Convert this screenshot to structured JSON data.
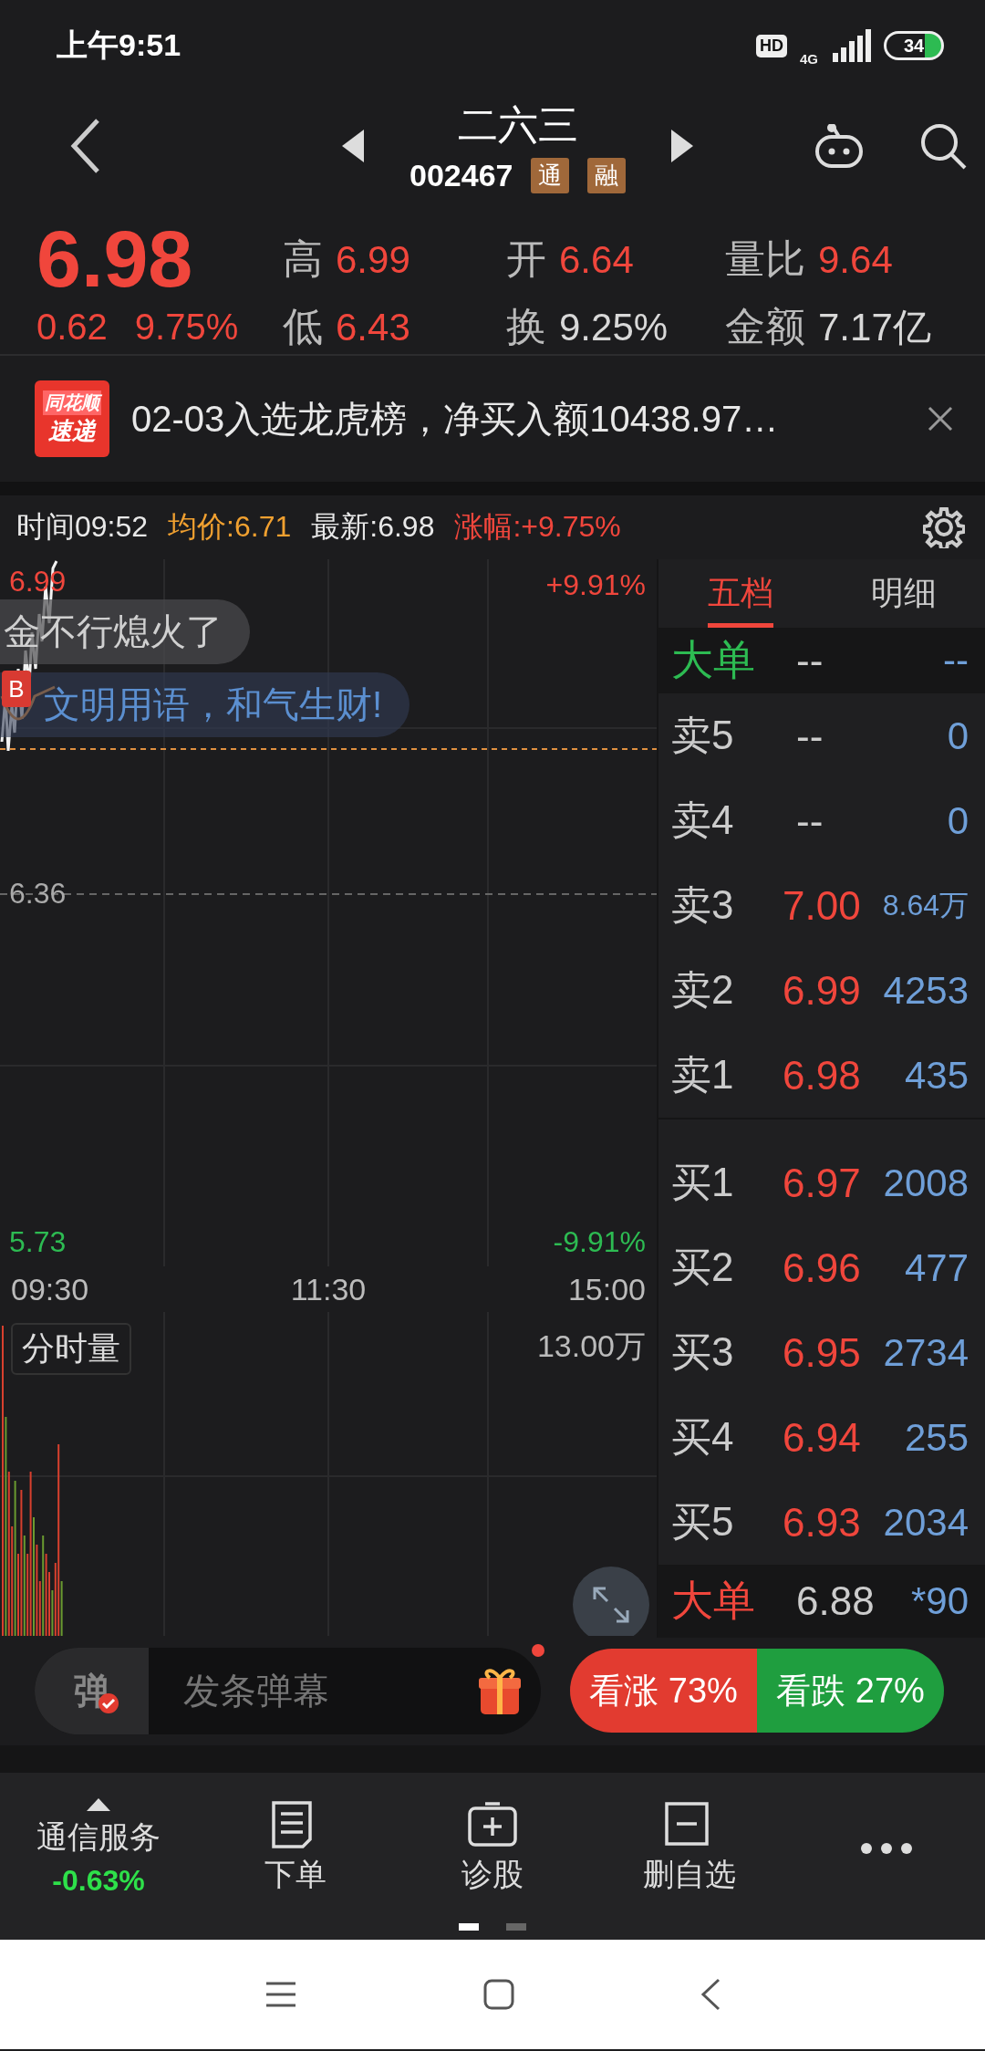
{
  "status_bar": {
    "time": "上午9:51",
    "hd_badge": "HD",
    "network": "4G",
    "battery": "34"
  },
  "header": {
    "title": "二六三",
    "code": "002467",
    "tags": [
      "通",
      "融"
    ]
  },
  "quote": {
    "price": "6.98",
    "change": "0.62",
    "change_pct": "9.75%",
    "stats": [
      {
        "label": "高",
        "value": "6.99",
        "color": "#f0463c"
      },
      {
        "label": "开",
        "value": "6.64",
        "color": "#f0463c"
      },
      {
        "label": "量比",
        "value": "9.64",
        "color": "#f0463c"
      },
      {
        "label": "低",
        "value": "6.43",
        "color": "#f0463c"
      },
      {
        "label": "换",
        "value": "9.25%",
        "color": "#d8d8d8"
      },
      {
        "label": "金额",
        "value": "7.17亿",
        "color": "#d8d8d8"
      }
    ]
  },
  "news": {
    "source_top": "同花顺",
    "source_bottom": "速递",
    "text": "02-03入选龙虎榜，净买入额10438.97…"
  },
  "chart_info": {
    "time_label": "时间09:52",
    "avg": "均价:6.71",
    "latest": "最新:6.98",
    "change": "涨幅:+9.75%"
  },
  "chart": {
    "high_price": "6.99",
    "high_pct": "+9.91%",
    "mid_price": "6.36",
    "low_price": "5.73",
    "low_pct": "-9.91%",
    "times": [
      "09:30",
      "11:30",
      "15:00"
    ],
    "volume_label": "分时量",
    "volume_max": "13.00万",
    "trade_marker": "B",
    "comments": [
      "金不行熄火了",
      "文明用语，和气生财!"
    ]
  },
  "order_book": {
    "tabs": [
      {
        "label": "五档",
        "selected": true
      },
      {
        "label": "明细",
        "selected": false
      }
    ],
    "big_top": {
      "label": "大单",
      "price": "--",
      "volume": "--",
      "color": "#2dbb52"
    },
    "asks": [
      {
        "label": "卖5",
        "price": "--",
        "volume": "0",
        "kind": "empty"
      },
      {
        "label": "卖4",
        "price": "--",
        "volume": "0",
        "kind": "empty"
      },
      {
        "label": "卖3",
        "price": "7.00",
        "volume": "8.64万",
        "kind": "compact"
      },
      {
        "label": "卖2",
        "price": "6.99",
        "volume": "4253",
        "kind": "quote"
      },
      {
        "label": "卖1",
        "price": "6.98",
        "volume": "435",
        "kind": "quote"
      }
    ],
    "bids": [
      {
        "label": "买1",
        "price": "6.97",
        "volume": "2008",
        "kind": "quote"
      },
      {
        "label": "买2",
        "price": "6.96",
        "volume": "477",
        "kind": "quote"
      },
      {
        "label": "买3",
        "price": "6.95",
        "volume": "2734",
        "kind": "quote"
      },
      {
        "label": "买4",
        "price": "6.94",
        "volume": "255",
        "kind": "quote"
      },
      {
        "label": "买5",
        "price": "6.93",
        "volume": "2034",
        "kind": "quote"
      }
    ],
    "big_bottom": {
      "label": "大单",
      "price": "6.88",
      "volume": "*90",
      "color": "#f0463c"
    }
  },
  "danmu": {
    "badge": "弹",
    "placeholder": "发条弹幕",
    "notification": true
  },
  "sentiment": {
    "bull": "看涨 73%",
    "bear": "看跌 27%"
  },
  "toolbar": {
    "sector": {
      "name": "通信服务",
      "change": "-0.63%"
    },
    "items": [
      {
        "label": "下单",
        "kind": "order"
      },
      {
        "label": "诊股",
        "kind": "diagnose"
      },
      {
        "label": "删自选",
        "kind": "remove"
      },
      {
        "kind": "more"
      }
    ],
    "pages": [
      {
        "selected": true
      },
      {
        "selected": false
      }
    ]
  }
}
